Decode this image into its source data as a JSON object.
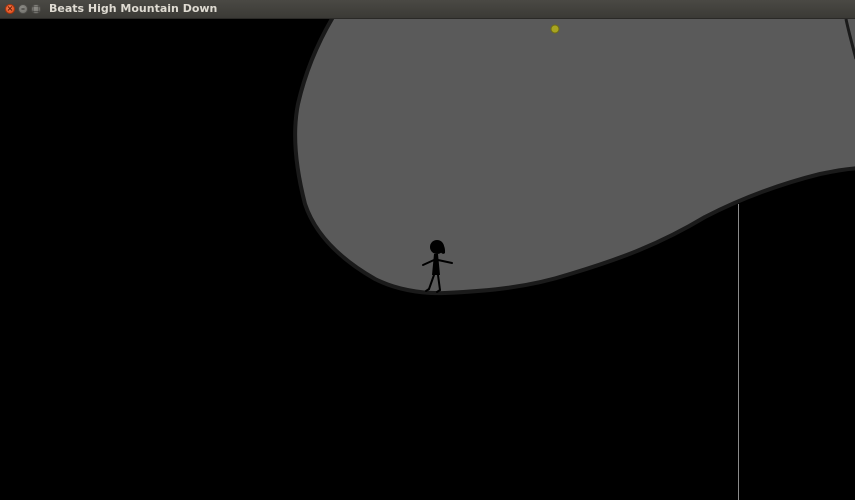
{
  "window": {
    "title": "Beats High Mountain Down",
    "buttons": {
      "close": "×",
      "minimize": "–",
      "maximize": "□"
    }
  },
  "scene": {
    "background_color": "#000000",
    "cave_fill_color": "#5a5a5a",
    "cave_outline_color": "#1a1a1a",
    "collectible_color": "#a8a420",
    "character_color": "#000000",
    "guide_line_color": "#8a8a8a"
  },
  "icons": {
    "character": "stick-figure-icon",
    "collectible": "orb-icon"
  }
}
